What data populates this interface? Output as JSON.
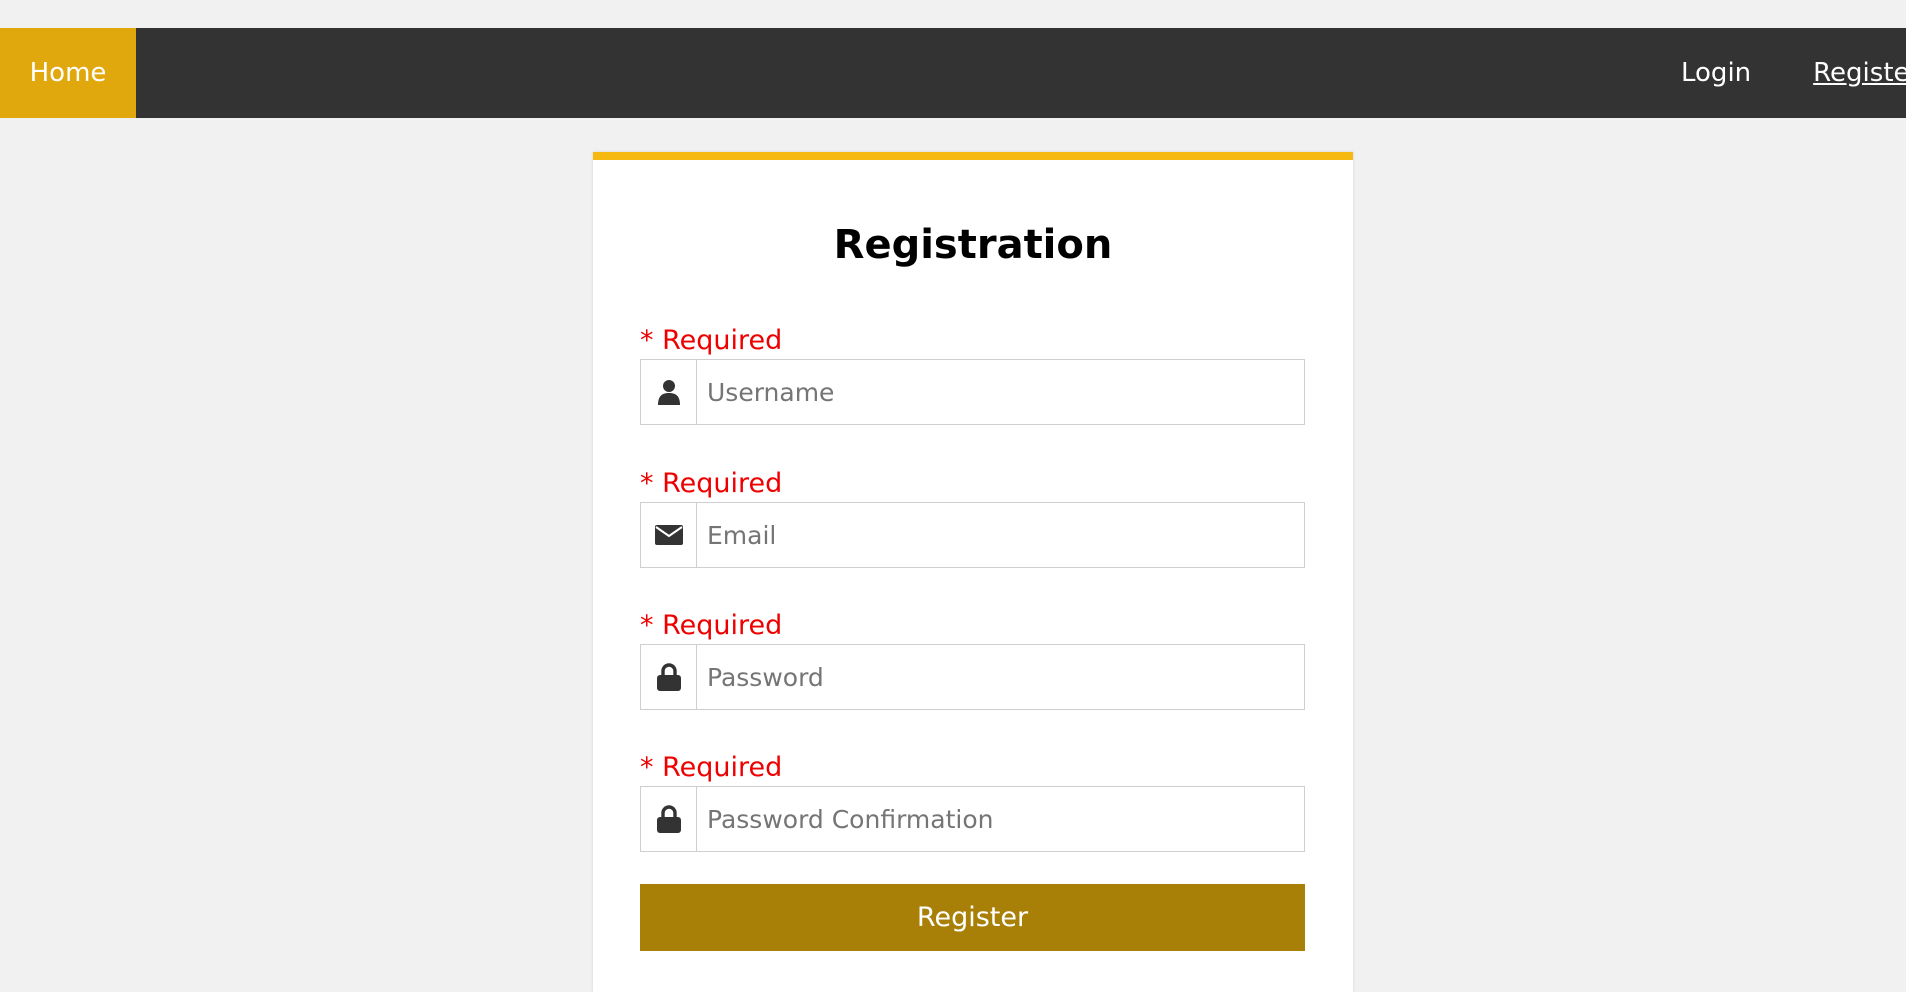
{
  "nav": {
    "home_label": "Home",
    "login_label": "Login",
    "register_label": "Register"
  },
  "form": {
    "title": "Registration",
    "required_label": "* Required",
    "fields": [
      {
        "icon": "user-icon",
        "placeholder": "Username",
        "value": ""
      },
      {
        "icon": "envelope-icon",
        "placeholder": "Email",
        "value": ""
      },
      {
        "icon": "lock-icon",
        "placeholder": "Password",
        "value": ""
      },
      {
        "icon": "lock-icon",
        "placeholder": "Password Confirmation",
        "value": ""
      }
    ],
    "submit_label": "Register"
  },
  "colors": {
    "nav_bg": "#333333",
    "home_active": "#e0a80c",
    "card_accent": "#f5b912",
    "required_text": "#ee0000",
    "button_bg": "#a98007"
  }
}
